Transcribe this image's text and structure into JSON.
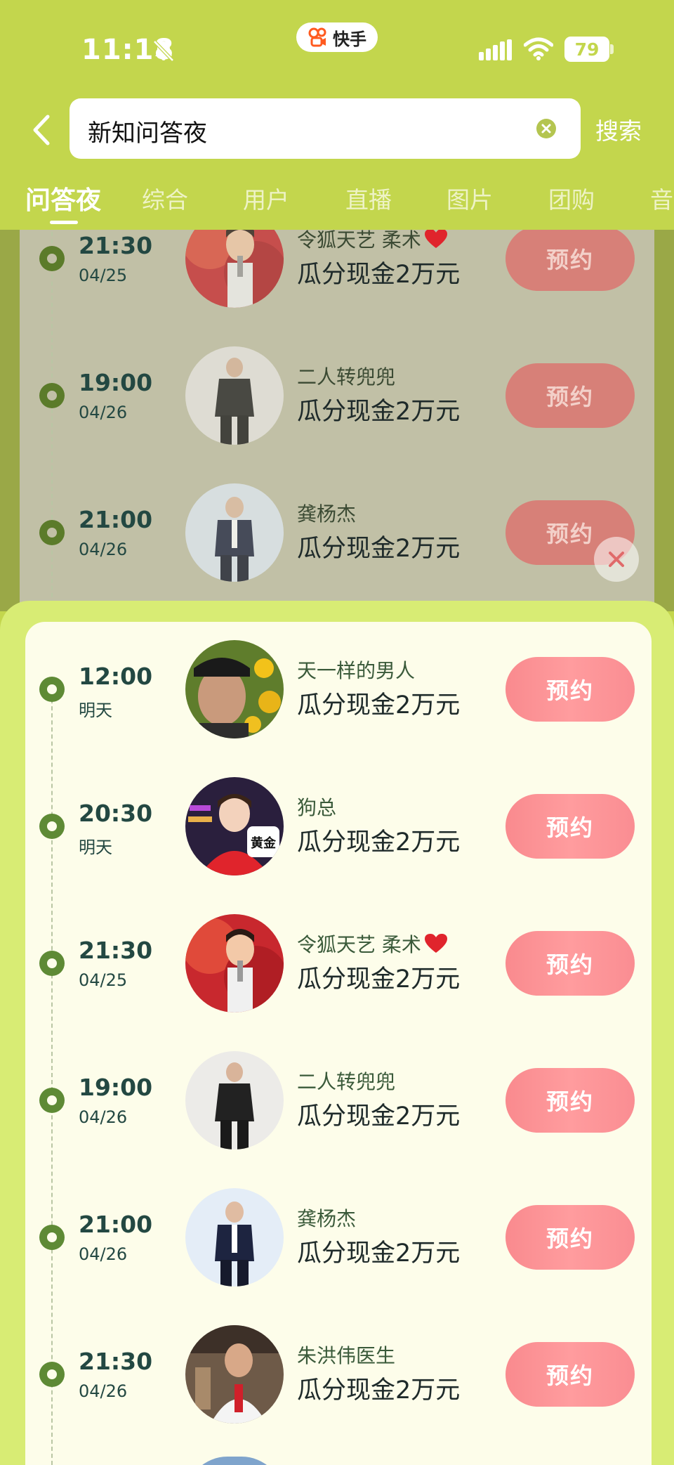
{
  "status_bar": {
    "time": "11:18",
    "app_name": "快手",
    "battery": "79"
  },
  "search": {
    "query": "新知问答夜",
    "button_label": "搜索"
  },
  "tabs": [
    "问答夜",
    "综合",
    "用户",
    "直播",
    "图片",
    "团购",
    "音"
  ],
  "background_list": [
    {
      "time": "21:30",
      "date": "04/25",
      "name": "令狐天艺 柔术",
      "prize": "瓜分现金2万元",
      "button": "预约"
    },
    {
      "time": "19:00",
      "date": "04/26",
      "name": "二人转兜兜",
      "prize": "瓜分现金2万元",
      "button": "预约"
    },
    {
      "time": "21:00",
      "date": "04/26",
      "name": "龚杨杰",
      "prize": "瓜分现金2万元",
      "button": "预约"
    }
  ],
  "popup_list": [
    {
      "time": "12:00",
      "date": "明天",
      "name": "天一样的男人",
      "prize": "瓜分现金2万元",
      "button": "预约"
    },
    {
      "time": "20:30",
      "date": "明天",
      "name": "狗总",
      "prize": "瓜分现金2万元",
      "button": "预约",
      "badge": "黄金"
    },
    {
      "time": "21:30",
      "date": "04/25",
      "name": "令狐天艺 柔术",
      "prize": "瓜分现金2万元",
      "button": "预约"
    },
    {
      "time": "19:00",
      "date": "04/26",
      "name": "二人转兜兜",
      "prize": "瓜分现金2万元",
      "button": "预约"
    },
    {
      "time": "21:00",
      "date": "04/26",
      "name": "龚杨杰",
      "prize": "瓜分现金2万元",
      "button": "预约"
    },
    {
      "time": "21:30",
      "date": "04/26",
      "name": "朱洪伟医生",
      "prize": "瓜分现金2万元",
      "button": "预约"
    }
  ],
  "icons": {
    "back": "back-arrow-icon",
    "clear": "clear-icon",
    "close": "close-icon",
    "heart": "heart-icon",
    "bell": "bell-muted-icon",
    "signal": "signal-icon",
    "wifi": "wifi-icon"
  },
  "colors": {
    "brand_green": "#c3d64d",
    "accent_pink": "#f98a8e",
    "timeline_green": "#5e8a35",
    "popup_bg": "#fdfdea"
  }
}
